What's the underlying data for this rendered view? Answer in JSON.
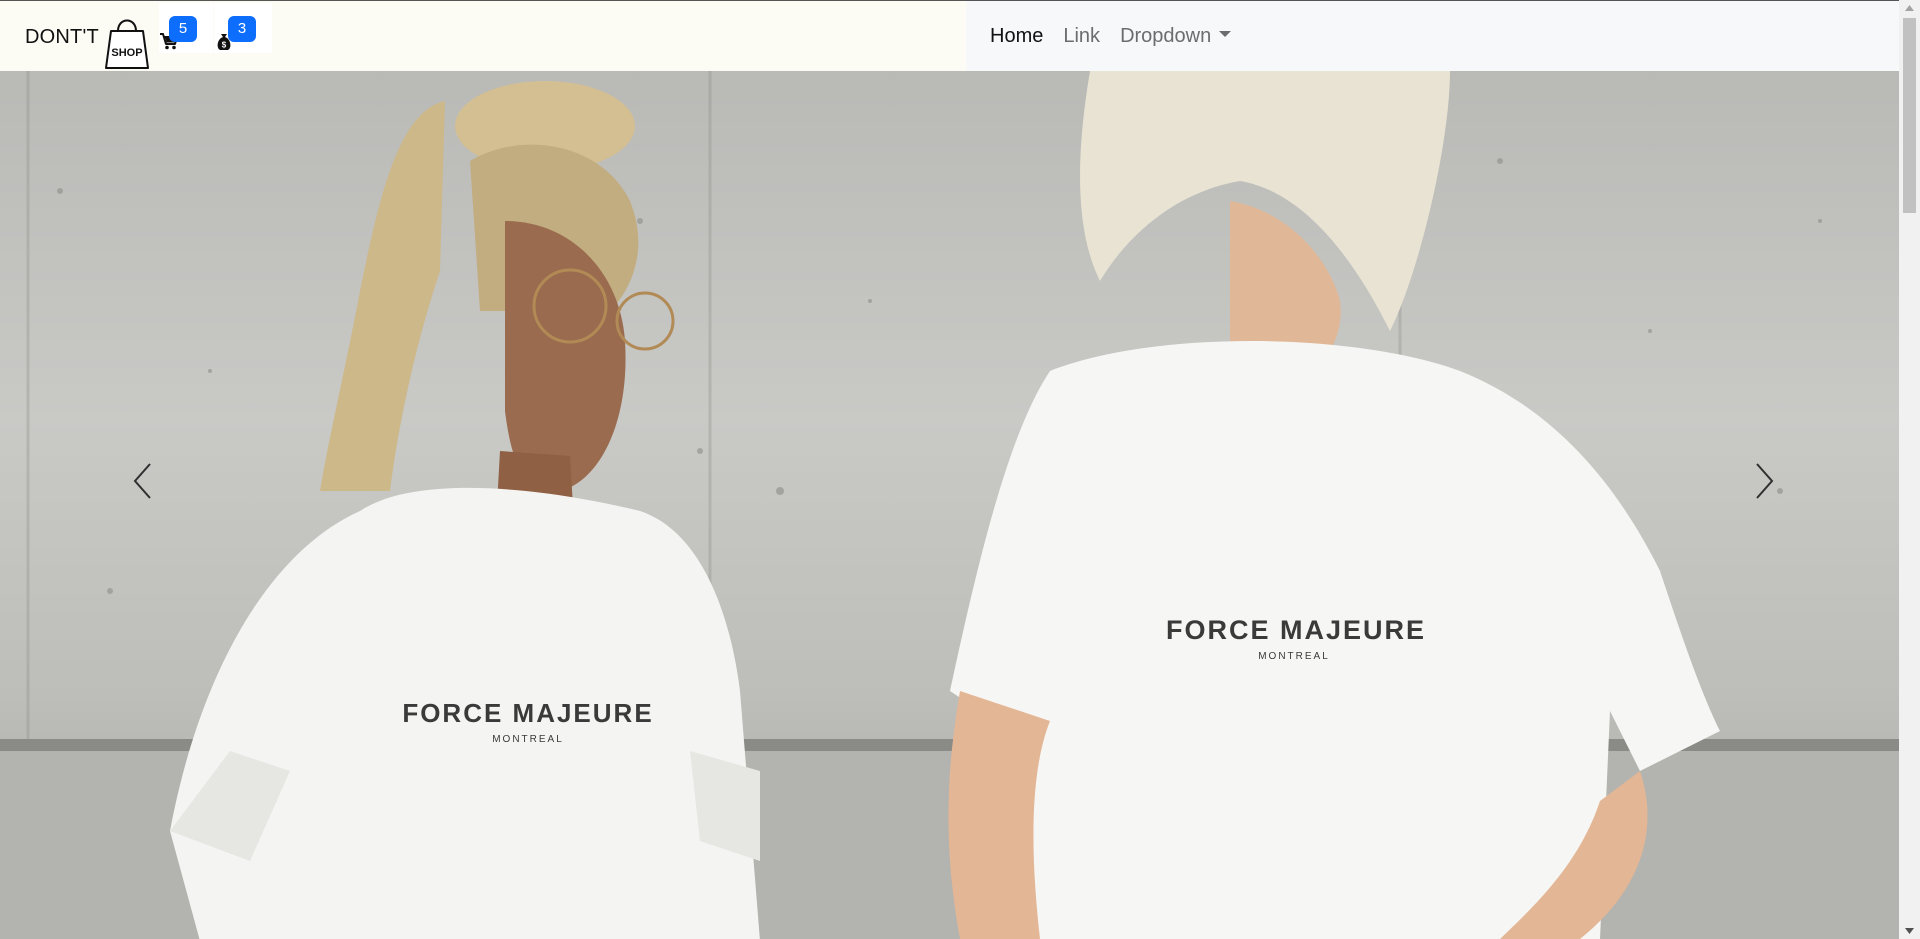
{
  "brand": {
    "text": "DONT'T",
    "bag_label": "SHOP"
  },
  "header_icons": {
    "cart": {
      "icon": "cart-icon",
      "badge": "5"
    },
    "money": {
      "icon": "money-bag-icon",
      "badge": "3"
    }
  },
  "nav": {
    "items": [
      {
        "label": "Home",
        "active": true
      },
      {
        "label": "Link",
        "active": false
      },
      {
        "label": "Dropdown",
        "active": false
      }
    ]
  },
  "carousel": {
    "slide": {
      "shirt_left": {
        "brand": "FORCE MAJEURE",
        "city": "MONTREAL"
      },
      "shirt_right": {
        "brand": "FORCE MAJEURE",
        "city": "MONTREAL"
      }
    },
    "controls": {
      "prev_icon": "chevron-left-icon",
      "next_icon": "chevron-right-icon"
    }
  },
  "colors": {
    "badge": "#0d6efd",
    "nav_left_bg": "#fcfcf5",
    "nav_right_bg": "#f7f8fa"
  }
}
